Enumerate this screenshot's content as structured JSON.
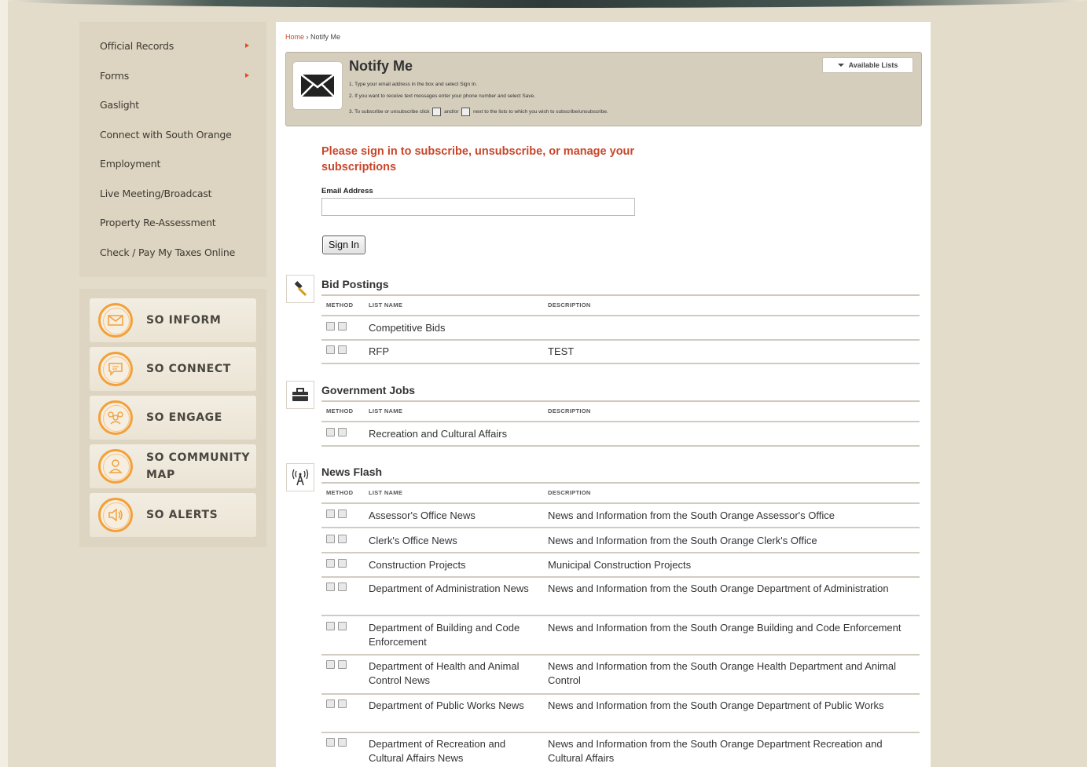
{
  "sidebar": {
    "items": [
      {
        "label": "Official Records",
        "has_submenu": true
      },
      {
        "label": "Forms",
        "has_submenu": true
      },
      {
        "label": "Gaslight",
        "has_submenu": false
      },
      {
        "label": "Connect with South Orange",
        "has_submenu": false
      },
      {
        "label": "Employment",
        "has_submenu": false
      },
      {
        "label": "Live Meeting/Broadcast",
        "has_submenu": false
      },
      {
        "label": "Property Re-Assessment",
        "has_submenu": false
      },
      {
        "label": "Check / Pay My Taxes Online",
        "has_submenu": false
      }
    ]
  },
  "so_buttons": [
    {
      "label": "SO INFORM",
      "icon": "envelope-icon"
    },
    {
      "label": "SO CONNECT",
      "icon": "chat-icon"
    },
    {
      "label": "SO ENGAGE",
      "icon": "people-icon"
    },
    {
      "label": "SO COMMUNITY MAP",
      "icon": "person-pin-icon"
    },
    {
      "label": "SO ALERTS",
      "icon": "speaker-icon"
    }
  ],
  "breadcrumb": {
    "home": "Home",
    "separator": "›",
    "current": "Notify Me"
  },
  "notify": {
    "title": "Notify Me",
    "step1": "1. Type your email address in the box and select Sign In.",
    "step2": "2. If you want to receive text messages enter your phone number and select Save.",
    "step3a": "3. To subscribe or unsubscribe click",
    "step3b": "and/or",
    "step3c": "next to the lists to which you wish to subscribe/unsubscribe.",
    "available_lists": "Available Lists"
  },
  "signin": {
    "message": "Please sign in to subscribe, unsubscribe, or manage your subscriptions",
    "email_label": "Email Address",
    "email_value": "",
    "button": "Sign In"
  },
  "columns": {
    "method": "METHOD",
    "list_name": "LIST NAME",
    "description": "DESCRIPTION"
  },
  "sections": [
    {
      "title": "Bid Postings",
      "icon": "gavel-icon",
      "rows": [
        {
          "name": "Competitive Bids",
          "description": ""
        },
        {
          "name": "RFP",
          "description": "TEST"
        }
      ]
    },
    {
      "title": "Government Jobs",
      "icon": "briefcase-icon",
      "rows": [
        {
          "name": "Recreation and Cultural Affairs",
          "description": ""
        }
      ]
    },
    {
      "title": "News Flash",
      "icon": "broadcast-tower-icon",
      "rows": [
        {
          "name": "Assessor's Office News",
          "description": "News and Information from the South Orange Assessor's Office"
        },
        {
          "name": "Clerk's Office News",
          "description": "News and Information from the South Orange Clerk's Office"
        },
        {
          "name": "Construction Projects",
          "description": "Municipal Construction Projects"
        },
        {
          "name": "Department of Administration News",
          "description": "News and Information from the South Orange Department of Administration"
        },
        {
          "name": "Department of Building and Code Enforcement",
          "description": "News and Information from the South Orange Building and Code Enforcement"
        },
        {
          "name": "Department of Health and Animal Control News",
          "description": "News and Information from the South Orange Health Department and Animal Control"
        },
        {
          "name": "Department of Public Works News",
          "description": "News and Information from the South Orange Department of Public Works"
        },
        {
          "name": "Department of Recreation and Cultural Affairs News",
          "description": "News and Information from the South Orange Department Recreation and Cultural Affairs"
        }
      ]
    }
  ],
  "colors": {
    "accent_red": "#c9462a",
    "so_orange": "#f2a03a",
    "panel_tan": "#ddd4c1"
  }
}
